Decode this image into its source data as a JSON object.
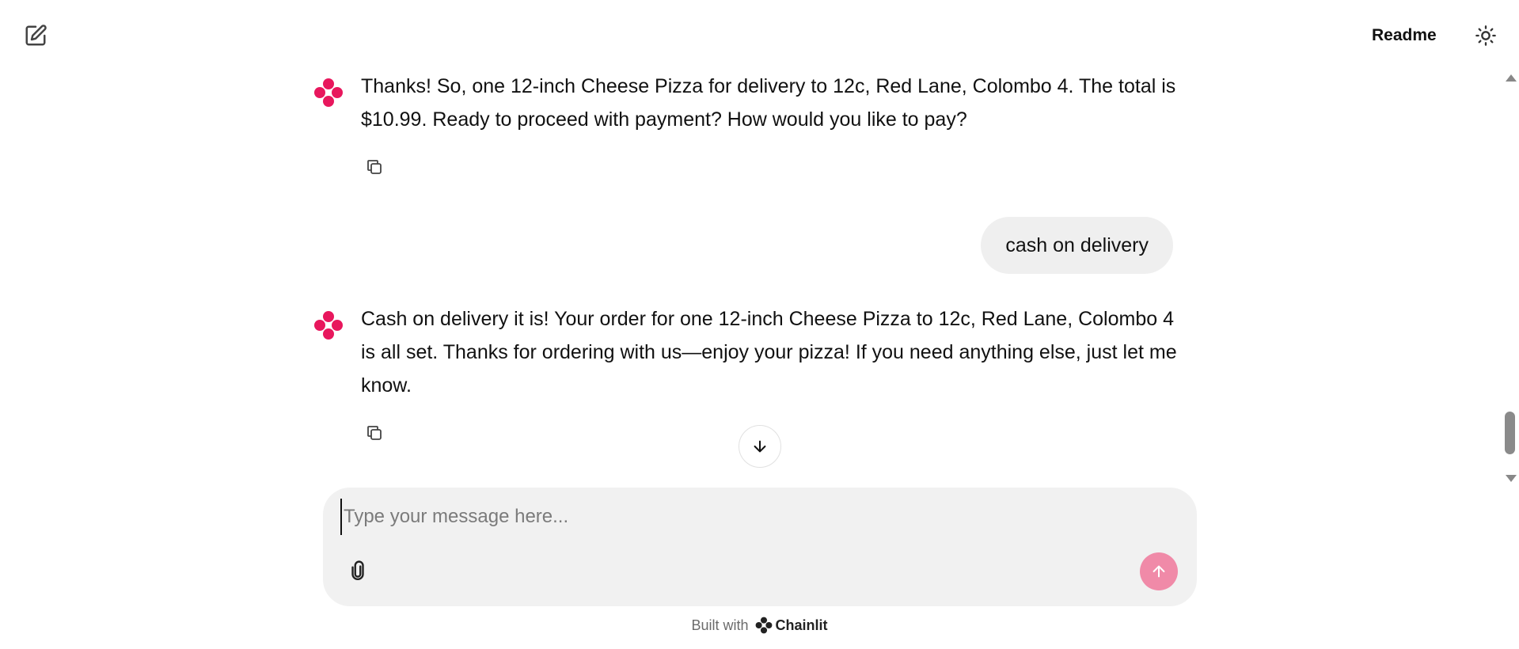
{
  "header": {
    "readme_label": "Readme"
  },
  "messages": [
    {
      "role": "assistant",
      "text": "Thanks! So, one 12-inch Cheese Pizza for delivery to 12c, Red Lane, Colombo 4. The total is $10.99. Ready to proceed with payment? How would you like to pay?"
    },
    {
      "role": "user",
      "text": "cash on delivery"
    },
    {
      "role": "assistant",
      "text": "Cash on delivery it is! Your order for one 12-inch Cheese Pizza to 12c, Red Lane, Colombo 4 is all set. Thanks for ordering with us—enjoy your pizza! If you need anything else, just let me know."
    }
  ],
  "composer": {
    "placeholder": "Type your message here...",
    "value": ""
  },
  "footer": {
    "built_with": "Built with",
    "brand": "Chainlit"
  },
  "colors": {
    "accent": "#e8175d",
    "send_button": "#f08aa8",
    "user_bubble": "#efefef",
    "composer_bg": "#f1f1f1"
  },
  "icons": {
    "new_chat": "edit-icon",
    "theme": "sun-icon",
    "copy": "copy-icon",
    "scroll_down": "arrow-down-icon",
    "attach": "paperclip-icon",
    "send": "arrow-up-icon",
    "avatar": "chainlit-logo-icon"
  }
}
